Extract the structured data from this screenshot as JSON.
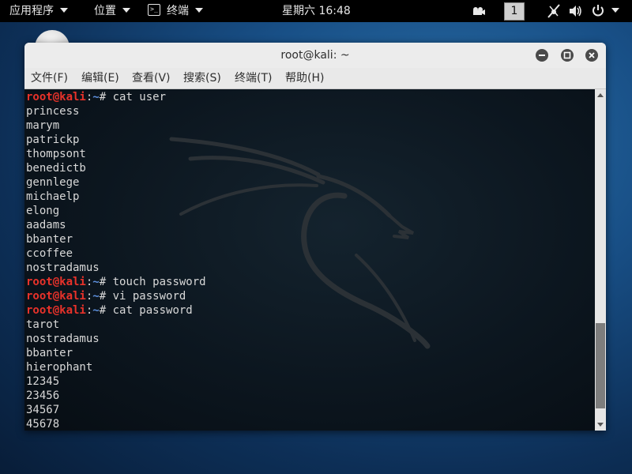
{
  "topbar": {
    "apps_label": "应用程序",
    "places_label": "位置",
    "terminal_label": "终端",
    "terminal_icon_glyph": ">_",
    "clock": "星期六 16:48",
    "workspace": "1"
  },
  "window": {
    "title": "root@kali: ~",
    "menu": [
      "文件(F)",
      "编辑(E)",
      "查看(V)",
      "搜索(S)",
      "终端(T)",
      "帮助(H)"
    ]
  },
  "terminal": {
    "prompt_user": "root@kali",
    "prompt_colon": ":",
    "prompt_path": "~",
    "prompt_symbol": "# ",
    "lines": [
      {
        "type": "prompt",
        "cmd": "cat user"
      },
      {
        "type": "out",
        "text": "princess"
      },
      {
        "type": "out",
        "text": "marym"
      },
      {
        "type": "out",
        "text": "patrickp"
      },
      {
        "type": "out",
        "text": "thompsont"
      },
      {
        "type": "out",
        "text": "benedictb"
      },
      {
        "type": "out",
        "text": "gennlege"
      },
      {
        "type": "out",
        "text": "michaelp"
      },
      {
        "type": "out",
        "text": "elong"
      },
      {
        "type": "out",
        "text": "aadams"
      },
      {
        "type": "out",
        "text": "bbanter"
      },
      {
        "type": "out",
        "text": "ccoffee"
      },
      {
        "type": "out",
        "text": "nostradamus"
      },
      {
        "type": "prompt",
        "cmd": "touch password"
      },
      {
        "type": "prompt",
        "cmd": "vi password"
      },
      {
        "type": "prompt",
        "cmd": "cat password"
      },
      {
        "type": "out",
        "text": "tarot"
      },
      {
        "type": "out",
        "text": "nostradamus"
      },
      {
        "type": "out",
        "text": "bbanter"
      },
      {
        "type": "out",
        "text": "hierophant"
      },
      {
        "type": "out",
        "text": "12345"
      },
      {
        "type": "out",
        "text": "23456"
      },
      {
        "type": "out",
        "text": "34567"
      },
      {
        "type": "out",
        "text": "45678"
      }
    ]
  },
  "colors": {
    "prompt_user": "#e8322a",
    "prompt_path": "#5d8fdc",
    "terminal_text": "#d8d8d8"
  }
}
